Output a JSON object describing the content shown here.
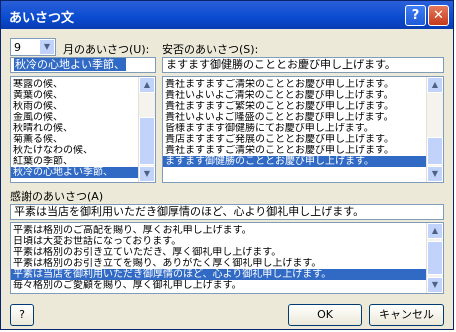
{
  "window": {
    "title": "あいさつ文",
    "help_btn": "?",
    "close_btn": "✕"
  },
  "month": {
    "value": "9",
    "label": "月のあいさつ(U):",
    "current": "秋冷の心地よい季節、",
    "items": [
      "寒露の候、",
      "黄葉の候、",
      "秋雨の候、",
      "金風の候、",
      "秋晴れの候、",
      "菊薫る候、",
      "秋たけなわの候、",
      "紅葉の季節、",
      "秋冷の心地よい季節、"
    ],
    "selected_index": 8
  },
  "anpi": {
    "label": "安否のあいさつ(S):",
    "current": "ますます御健勝のこととお慶び申し上げます。",
    "items": [
      "貴社ますますご清栄のこととお慶び申し上げます。",
      "貴社いよいよご清栄のこととお慶び申し上げます。",
      "貴社ますますご繁栄のこととお慶び申し上げます。",
      "貴社いよいよご隆盛のこととお慶び申し上げます。",
      "皆様ますます御健勝にてお慶び申し上げます。",
      "貴店ますますご発展のこととお慶び申し上げます。",
      "貴社ますますご清栄のこととお慶び申し上げます。",
      "ますます御健勝のこととお慶び申し上げます。"
    ],
    "selected_index": 7
  },
  "thanks": {
    "label": "感謝のあいさつ(A)",
    "current": "平素は当店を御利用いただき御厚情のほど、心より御礼申し上げます。",
    "items": [
      "平素は格別のご高配を賜り、厚くお礼申し上げます。",
      "日頃は大変お世話になっております。",
      "平素は格別のお引き立ていただき、厚く御礼申し上げます。",
      "平素は格別のお引き立てを賜り、ありがたく厚く御礼申し上げます。",
      "平素は当店を御利用いただき御厚情のほど、心より御礼申し上げます。",
      "毎々格別のご愛顧を賜り、厚く御礼申し上げます。"
    ],
    "selected_index": 4
  },
  "buttons": {
    "help": "?",
    "ok": "OK",
    "cancel": "キャンセル"
  }
}
